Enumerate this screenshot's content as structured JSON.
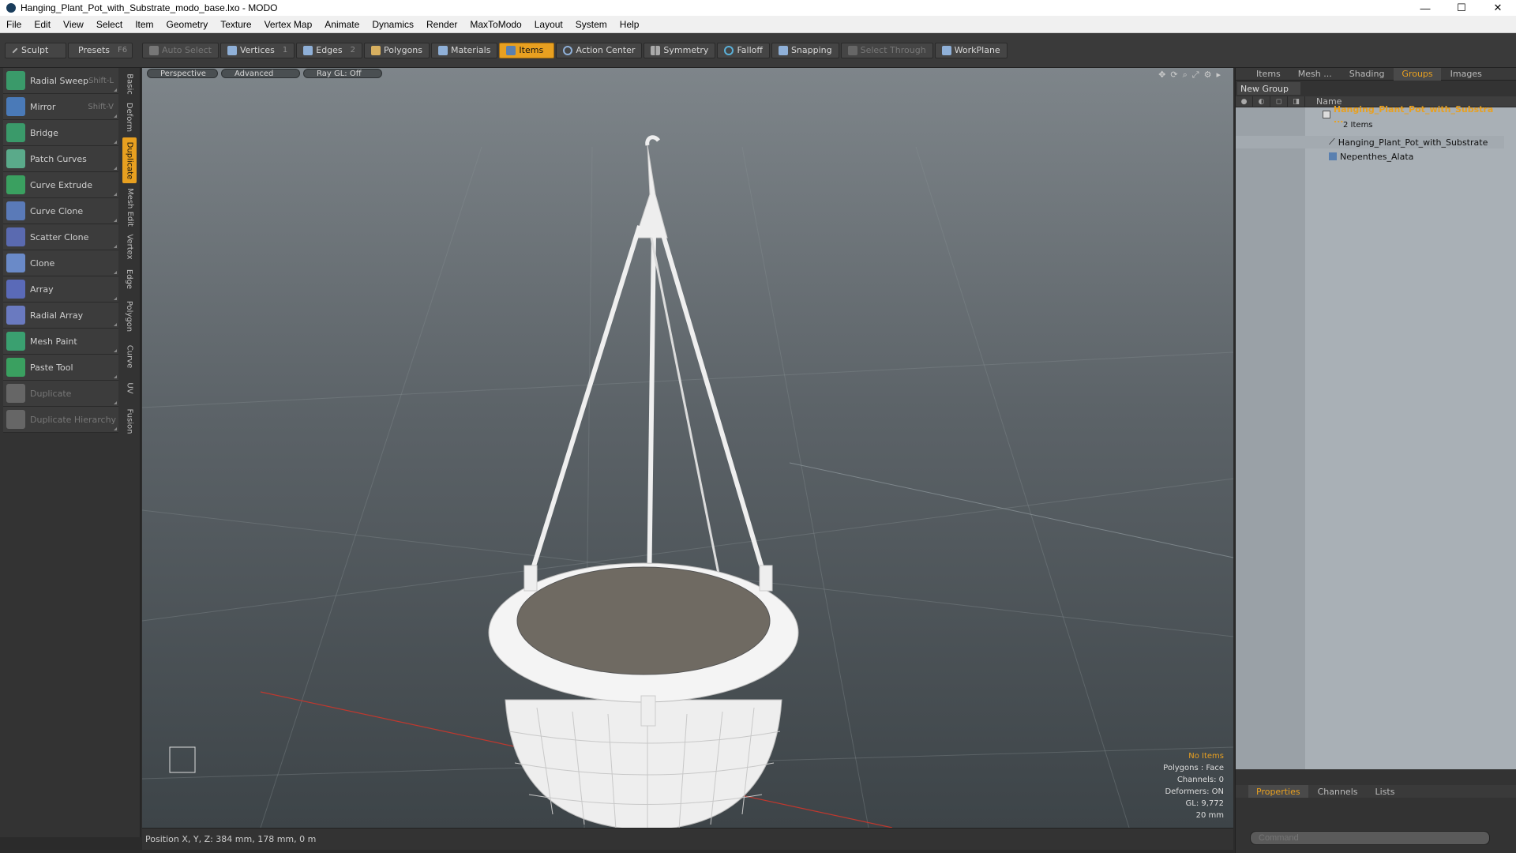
{
  "window": {
    "title": "Hanging_Plant_Pot_with_Substrate_modo_base.lxo - MODO",
    "minimize": "—",
    "maximize": "☐",
    "close": "✕"
  },
  "menu": [
    "File",
    "Edit",
    "View",
    "Select",
    "Item",
    "Geometry",
    "Texture",
    "Vertex Map",
    "Animate",
    "Dynamics",
    "Render",
    "MaxToModo",
    "Layout",
    "System",
    "Help"
  ],
  "toolbar": {
    "sculpt": "Sculpt",
    "presets": "Presets",
    "presets_hk": "F6",
    "auto_select": "Auto Select",
    "vertices": "Vertices",
    "vertices_hk": "1",
    "edges": "Edges",
    "edges_hk": "2",
    "polygons": "Polygons",
    "materials": "Materials",
    "items": "Items",
    "action_center": "Action Center",
    "symmetry": "Symmetry",
    "falloff": "Falloff",
    "snapping": "Snapping",
    "select_through": "Select Through",
    "workplane": "WorkPlane"
  },
  "tools": [
    {
      "label": "Radial Sweep",
      "hk": "Shift-L",
      "color": "#3a9a6a"
    },
    {
      "label": "Mirror",
      "hk": "Shift-V",
      "color": "#4a7ab8"
    },
    {
      "label": "Bridge",
      "hk": "",
      "color": "#3a9a6a"
    },
    {
      "label": "Patch Curves",
      "hk": "",
      "color": "#5aaa8a"
    },
    {
      "label": "Curve Extrude",
      "hk": "",
      "color": "#3aa060"
    },
    {
      "label": "Curve Clone",
      "hk": "",
      "color": "#5a7ab8"
    },
    {
      "label": "Scatter Clone",
      "hk": "",
      "color": "#5a6ab0"
    },
    {
      "label": "Clone",
      "hk": "",
      "color": "#6a8ac8"
    },
    {
      "label": "Array",
      "hk": "",
      "color": "#5a6ab8"
    },
    {
      "label": "Radial Array",
      "hk": "",
      "color": "#6a7ac0"
    },
    {
      "label": "Mesh Paint",
      "hk": "",
      "color": "#3aa070"
    },
    {
      "label": "Paste Tool",
      "hk": "",
      "color": "#3aa060"
    },
    {
      "label": "Duplicate",
      "hk": "",
      "color": "#666666"
    },
    {
      "label": "Duplicate Hierarchy",
      "hk": "",
      "color": "#666666"
    }
  ],
  "vtabs": [
    "Basic",
    "Deform",
    "Duplicate",
    "Mesh Edit",
    "Vertex",
    "Edge",
    "Polygon",
    "Curve",
    "UV",
    "Fusion"
  ],
  "viewport": {
    "view": "Perspective",
    "shading": "Advanced",
    "raygl": "Ray GL: Off",
    "info": {
      "items": "No Items",
      "polygons": "Polygons : Face",
      "channels": "Channels: 0",
      "deformers": "Deformers: ON",
      "gl": "GL: 9,772",
      "scale": "20 mm"
    }
  },
  "status": {
    "position": "Position X, Y, Z:   384 mm, 178 mm, 0 m"
  },
  "right": {
    "tabs": [
      "Items",
      "Mesh ...",
      "Shading",
      "Groups",
      "Images"
    ],
    "active_tab": "Groups",
    "new_group": "New Group",
    "name_col": "Name",
    "group_name": "Hanging_Plant_Pot_with_Substra ...",
    "group_count": "2 Items",
    "children": [
      "Hanging_Plant_Pot_with_Substrate",
      "Nepenthes_Alata"
    ],
    "props_tabs": [
      "Properties",
      "Channels",
      "Lists"
    ],
    "command_placeholder": "Command"
  },
  "colors": {
    "accent": "#e8a020",
    "mesh": "#f2f2f2",
    "soil": "#6f6a62"
  }
}
